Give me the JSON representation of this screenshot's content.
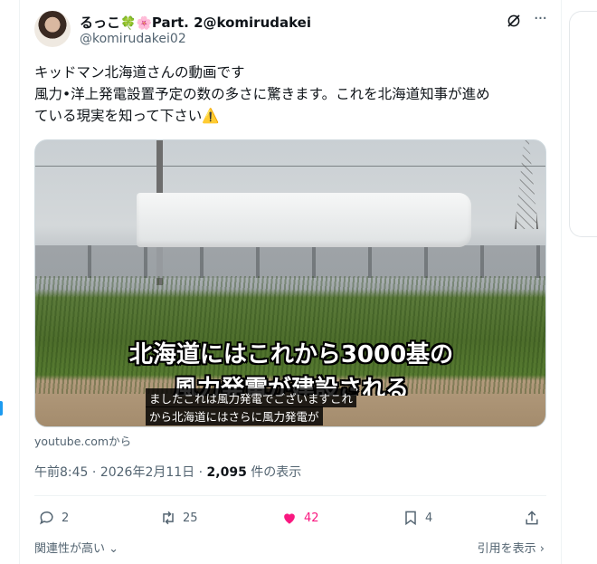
{
  "author": {
    "name_prefix": "るっこ",
    "clover": "🍀",
    "flower": "🌸",
    "name_suffix": "Part. 2@komirudakei",
    "handle": "@komirudakei02"
  },
  "post": {
    "line1": "キッドマン北海道さんの動画です",
    "line2": "風力•洋上発電設置予定の数の多さに驚きます。これを北海道知事が進め",
    "line3": "ている現実を知って下さい",
    "warning_emoji": "⚠️"
  },
  "media": {
    "caption_big_1": "北海道にはこれから3000基の",
    "caption_big_2": "風力発電が建設される",
    "subtitle_1": "ましたこれは風力発電でございますこれ",
    "subtitle_2": "から北海道にはさらに風力発電が"
  },
  "source": "youtube.comから",
  "meta": {
    "time": "午前8:45",
    "sep1": " · ",
    "date": "2026年2月11日",
    "sep2": " · ",
    "views": "2,095",
    "views_label": " 件の表示"
  },
  "actions": {
    "replies": "2",
    "reposts": "25",
    "likes": "42",
    "bookmarks": "4"
  },
  "footer": {
    "relevance": "関連性が高い",
    "quotes": "引用を表示"
  },
  "colors": {
    "like": "#f91880",
    "secondary_text": "#536471",
    "accent": "#1d9bf0"
  }
}
